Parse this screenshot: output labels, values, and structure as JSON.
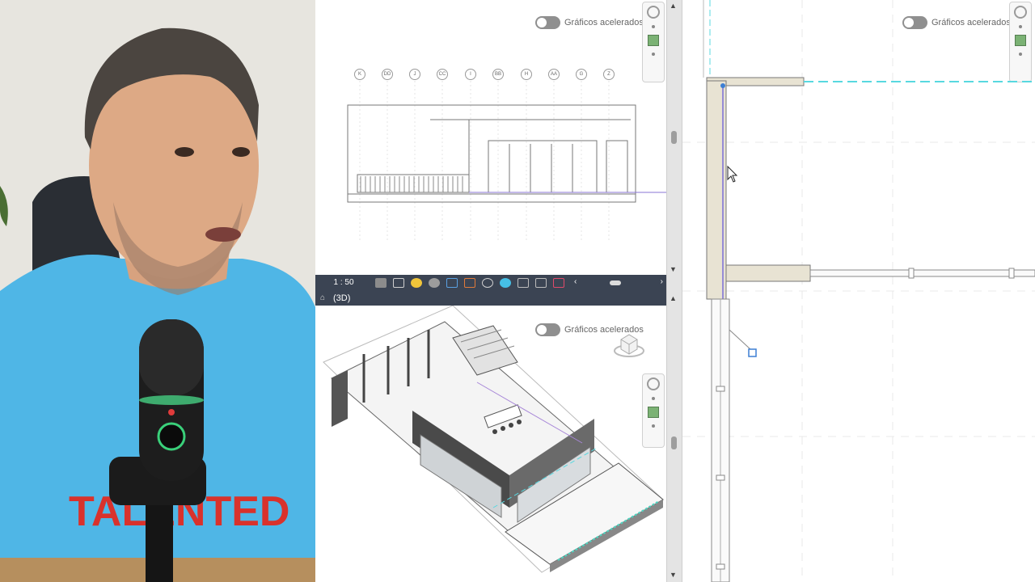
{
  "elevation_view": {
    "toggle_label": "Gráficos acelerados",
    "grid_bubbles": [
      "K",
      "DD",
      "J",
      "CC",
      "I",
      "BB",
      "H",
      "AA",
      "G",
      "Z"
    ]
  },
  "view_control_bar": {
    "scale": "1 : 50"
  },
  "view_3d": {
    "tab_label": "(3D)",
    "toggle_label": "Gráficos acelerados"
  },
  "plan_view": {
    "toggle_label": "Gráficos acelerados"
  },
  "colors": {
    "toolbar_bg": "#3b4453",
    "wall_fill": "#e8e3d3",
    "dashed_line": "#58d8e0",
    "selection_blue": "#3d7fd4"
  }
}
